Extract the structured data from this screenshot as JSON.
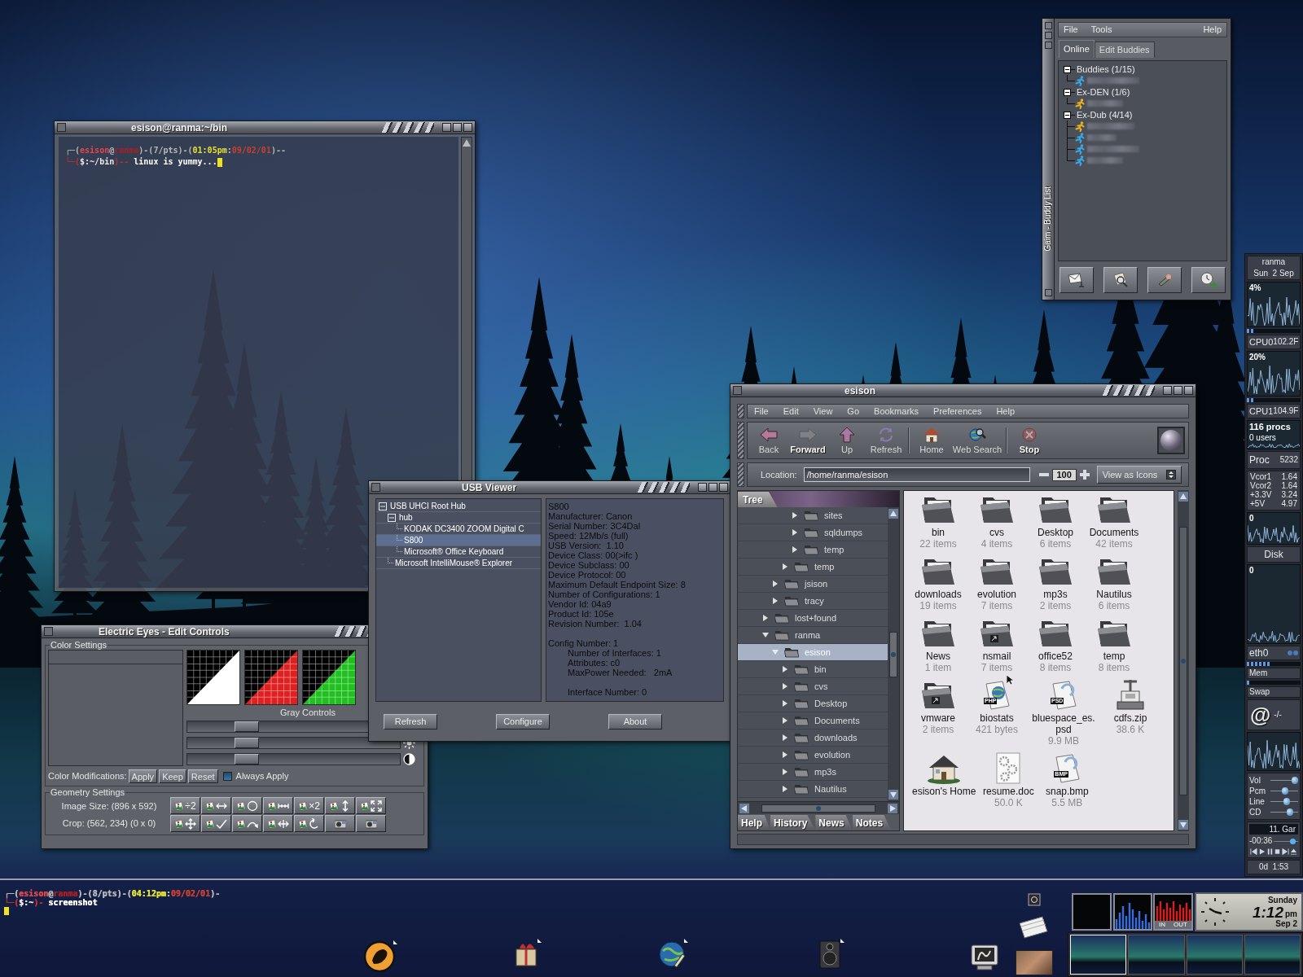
{
  "terminal": {
    "title": "esison@ranma:~/bin",
    "lines": [
      {
        "segments": [
          {
            "text": "┌─(",
            "color": "#b8b8b8"
          },
          {
            "text": "esison",
            "color": "#e04848"
          },
          {
            "text": "@",
            "color": "#b8b8b8"
          },
          {
            "text": "ranma",
            "color": "#a82020"
          },
          {
            "text": ")-(",
            "color": "#b8b8b8"
          },
          {
            "text": "7/pts",
            "color": "#b8b8b8"
          },
          {
            "text": ")-(",
            "color": "#b8b8b8"
          },
          {
            "text": "01:05pm",
            "color": "#e8e030"
          },
          {
            "text": ":",
            "color": "#b8b8b8"
          },
          {
            "text": "09/02/01",
            "color": "#c84030"
          },
          {
            "text": ")--",
            "color": "#b8b8b8"
          }
        ]
      },
      {
        "segments": [
          {
            "text": "└─(",
            "color": "#c03030"
          },
          {
            "text": "$:~/bin",
            "color": "#e8e8e8"
          },
          {
            "text": ")--",
            "color": "#c03030"
          },
          {
            "text": " linux is yummy...",
            "color": "#ffffff"
          }
        ],
        "cursor": true
      }
    ]
  },
  "buddy_list": {
    "title": "Gaim - Buddy List",
    "menu": [
      "File",
      "Tools",
      "Help"
    ],
    "tabs": [
      {
        "label": "Online",
        "selected": true
      },
      {
        "label": "Edit Buddies",
        "selected": false
      }
    ],
    "groups": [
      {
        "label": "Buddies (1/15)",
        "expanded": true,
        "children": [
          {
            "away": false
          }
        ]
      },
      {
        "label": "Ex-DEN (1/6)",
        "expanded": true,
        "children": [
          {
            "away": true
          }
        ]
      },
      {
        "label": "Ex-Dub (4/14)",
        "expanded": true,
        "children": [
          {
            "away": true
          },
          {
            "away": false
          },
          {
            "away": false
          },
          {
            "away": false
          }
        ]
      }
    ]
  },
  "electric_eyes": {
    "title": "Electric Eyes - Edit Controls",
    "color_settings": {
      "label": "Color Settings",
      "swatches": [
        {
          "color": "#ffffff"
        },
        {
          "color": "#e02020"
        },
        {
          "color": "#20c020"
        }
      ],
      "controls_label": "Gray Controls",
      "sliders": [
        {
          "kind": "plain",
          "level": 0.25
        },
        {
          "kind": "brightness",
          "level": 0.25
        },
        {
          "kind": "contrast",
          "level": 0.25
        }
      ],
      "modifications_label": "Color Modifications:",
      "buttons": [
        "Apply",
        "Keep",
        "Reset"
      ],
      "always_apply": {
        "label": "Always Apply",
        "checked": false
      }
    },
    "geometry": {
      "label": "Geometry Settings",
      "image_size": "Image Size: (896 x 592)",
      "crop": "Crop: (562, 234) (0 x 0)",
      "buttons": [
        {
          "kind": "scale",
          "glyph": "÷2"
        },
        {
          "kind": "shrink"
        },
        {
          "kind": "circle"
        },
        {
          "kind": "grow"
        },
        {
          "kind": "scale",
          "glyph": "×2"
        },
        {
          "kind": "flip-vertical"
        },
        {
          "kind": "fit"
        },
        {
          "kind": "move"
        },
        {
          "kind": "check"
        },
        {
          "kind": "rotate-arc"
        },
        {
          "kind": "flip-horizontal"
        },
        {
          "kind": "rotate"
        },
        {
          "kind": "camera"
        },
        {
          "kind": "camera"
        }
      ]
    }
  },
  "usb_viewer": {
    "title": "USB Viewer",
    "tree": [
      {
        "label": "USB UHCI Root Hub",
        "expanded": true,
        "selected": false,
        "children": [
          {
            "label": "hub",
            "expanded": true,
            "selected": false,
            "children": [
              {
                "label": "KODAK DC3400 ZOOM Digital C",
                "selected": false
              },
              {
                "label": "S800",
                "selected": true
              },
              {
                "label": "Microsoft® Office Keyboard",
                "selected": false
              }
            ]
          },
          {
            "label": "Microsoft IntelliMouse® Explorer",
            "selected": false
          }
        ]
      }
    ],
    "details": [
      "S800",
      "Manufacturer: Canon",
      "Serial Number: 3C4Dal",
      "Speed: 12Mb/s (full)",
      "USB Version:  1.10",
      "Device Class: 00(>ifc )",
      "Device Subclass: 00",
      "Device Protocol: 00",
      "Maximum Default Endpoint Size: 8",
      "Number of Configurations: 1",
      "Vendor Id: 04a9",
      "Product Id: 105e",
      "Revision Number:  1.04"
    ],
    "config": {
      "heading": "Config Number: 1",
      "lines": [
        "Number of Interfaces: 1",
        "Attributes: c0",
        "MaxPower Needed:   2mA"
      ],
      "interface": "Interface Number: 0"
    },
    "buttons": [
      "Refresh",
      "Configure",
      "About"
    ]
  },
  "file_manager": {
    "title": "esison",
    "menu": [
      "File",
      "Edit",
      "View",
      "Go",
      "Bookmarks",
      "Preferences",
      "Help"
    ],
    "toolbar": [
      {
        "kind": "back",
        "label": "Back",
        "disabled": false
      },
      {
        "kind": "forward",
        "label": "Forward",
        "disabled": true
      },
      {
        "kind": "up",
        "label": "Up",
        "disabled": false
      },
      {
        "kind": "refresh",
        "label": "Refresh",
        "disabled": false,
        "separator_after": true
      },
      {
        "kind": "home",
        "label": "Home",
        "disabled": false
      },
      {
        "kind": "search",
        "label": "Web Search",
        "disabled": false,
        "separator_after": true
      },
      {
        "kind": "stop",
        "label": "Stop",
        "disabled": true
      }
    ],
    "location": {
      "label": "Location:",
      "value": "/home/ranma/esison"
    },
    "zoom": "100",
    "view_as": "View as Icons",
    "sidebar": {
      "open_panel": "Tree",
      "tree": [
        {
          "children": [
            {
              "children": [
                {
                  "children": [
                    {
                      "label": "sites",
                      "expanded": false,
                      "selected": false
                    },
                    {
                      "label": "sqldumps",
                      "expanded": false,
                      "selected": false
                    },
                    {
                      "label": "temp",
                      "expanded": false,
                      "selected": false
                    }
                  ]
                },
                {
                  "label": "temp",
                  "expanded": false,
                  "selected": false
                }
              ]
            },
            {
              "label": "jsison",
              "expanded": false,
              "selected": false
            },
            {
              "label": "tracy",
              "expanded": false,
              "selected": false
            }
          ]
        },
        {
          "label": "lost+found",
          "expanded": false,
          "selected": false
        },
        {
          "label": "ranma",
          "expanded": true,
          "selected": false,
          "children": [
            {
              "label": "esison",
              "expanded": true,
              "selected": true,
              "children": [
                {
                  "label": "bin",
                  "expanded": false,
                  "selected": false
                },
                {
                  "label": "cvs",
                  "expanded": false,
                  "selected": false
                },
                {
                  "label": "Desktop",
                  "expanded": false,
                  "selected": false
                },
                {
                  "label": "Documents",
                  "expanded": false,
                  "selected": false
                },
                {
                  "label": "downloads",
                  "expanded": false,
                  "selected": false
                },
                {
                  "label": "evolution",
                  "expanded": false,
                  "selected": false
                },
                {
                  "label": "mp3s",
                  "expanded": false,
                  "selected": false
                },
                {
                  "label": "Nautilus",
                  "expanded": false,
                  "selected": false
                }
              ]
            }
          ]
        }
      ],
      "tabs": [
        {
          "label": "Help",
          "selected": false
        },
        {
          "label": "History",
          "selected": false
        },
        {
          "label": "News",
          "selected": false
        },
        {
          "label": "Notes",
          "selected": false
        }
      ]
    },
    "icons": [
      {
        "name": "bin",
        "info": "22 items",
        "kind": "folder"
      },
      {
        "name": "cvs",
        "info": "4 items",
        "kind": "folder"
      },
      {
        "name": "Desktop",
        "info": "6 items",
        "kind": "folder"
      },
      {
        "name": "Documents",
        "info": "42 items",
        "kind": "folder"
      },
      {
        "name": "downloads",
        "info": "19 items",
        "kind": "folder"
      },
      {
        "name": "evolution",
        "info": "7 items",
        "kind": "folder"
      },
      {
        "name": "mp3s",
        "info": "2 items",
        "kind": "folder"
      },
      {
        "name": "Nautilus",
        "info": "6 items",
        "kind": "folder"
      },
      {
        "name": "News",
        "info": "1 item",
        "kind": "folder"
      },
      {
        "name": "nsmail",
        "info": "7 items",
        "kind": "folder-link"
      },
      {
        "name": "office52",
        "info": "8 items",
        "kind": "folder"
      },
      {
        "name": "temp",
        "info": "8 items",
        "kind": "folder"
      },
      {
        "name": "vmware",
        "info": "2 items",
        "kind": "folder-link"
      },
      {
        "name": "biostats",
        "info": "421 bytes",
        "kind": "web-file",
        "badge": "PHP"
      },
      {
        "name": "bluespace_es.psd",
        "info": "9.9 MB",
        "kind": "image-file",
        "badge": "PSD"
      },
      {
        "name": "cdfs.zip",
        "info": "38.6 K",
        "kind": "archive"
      },
      {
        "name": "esison's Home",
        "kind": "home"
      },
      {
        "name": "resume.doc",
        "info": "50.0 K",
        "kind": "document"
      },
      {
        "name": "snap.bmp",
        "info": "5.5 MB",
        "kind": "image-file",
        "badge": "BMP"
      }
    ]
  },
  "gkrellm": {
    "host": "ranma",
    "date": "Sun  2 Sep",
    "cpus": [
      {
        "chart_label": "4%",
        "name": "CPU0",
        "temp": "102.2F",
        "level": 0.15
      },
      {
        "chart_label": "20%",
        "name": "CPU1",
        "temp": "104.9F",
        "level": 0.15
      }
    ],
    "procs": {
      "procs": "116 procs",
      "users": "0 users"
    },
    "proc": {
      "label": "Proc",
      "value": "5232"
    },
    "sensors": [
      {
        "name": "Vcor1",
        "value": "1.64"
      },
      {
        "name": "Vcor2",
        "value": "1.64"
      },
      {
        "name": "+3.3V",
        "value": "3.24"
      },
      {
        "name": "+5V",
        "value": "4.97"
      }
    ],
    "sensor_chart_label": "0",
    "disk": {
      "label": "Disk",
      "chart_label": "0"
    },
    "net": {
      "label": "eth0"
    },
    "mem": {
      "label": "Mem",
      "level": 0.45
    },
    "swap": {
      "label": "Swap",
      "level": 0.05
    },
    "mail": {
      "icon": "@",
      "count": "-/-"
    },
    "mixer": [
      {
        "label": "Vol",
        "level": 1
      },
      {
        "label": "Pcm",
        "level": 0.55
      },
      {
        "label": "Line",
        "level": 0.6
      },
      {
        "label": "CD",
        "level": 0.75
      }
    ],
    "player": {
      "title": "11. Gar",
      "time": "-00:36",
      "level": 0.85
    },
    "uptime": "0d  1:53"
  },
  "bottom_terminal": {
    "lines": [
      {
        "segments": [
          {
            "text": "┌─(",
            "color": "#b8b8b8"
          },
          {
            "text": "esison",
            "color": "#e04848"
          },
          {
            "text": "@",
            "color": "#b8b8b8"
          },
          {
            "text": "ranma",
            "color": "#a82020"
          },
          {
            "text": ")-(",
            "color": "#b8b8b8"
          },
          {
            "text": "8/pts",
            "color": "#b8b8b8"
          },
          {
            "text": ")-(",
            "color": "#b8b8b8"
          },
          {
            "text": "04:12pm",
            "color": "#e8e030"
          },
          {
            "text": ":",
            "color": "#b8b8b8"
          },
          {
            "text": "09/02/01",
            "color": "#c84030"
          },
          {
            "text": ")-",
            "color": "#b8b8b8"
          }
        ]
      },
      {
        "segments": [
          {
            "text": "└─(",
            "color": "#c03030"
          },
          {
            "text": "$:~",
            "color": "#e8e8e8"
          },
          {
            "text": ")-",
            "color": "#c03030"
          },
          {
            "text": " screenshot",
            "color": "#ffffff"
          }
        ]
      },
      {
        "cursor": true
      }
    ]
  },
  "dock": {
    "meter_labels": [
      "IN",
      "OUT"
    ],
    "clock": {
      "day": "Sunday",
      "time": "1:12",
      "period": "pm",
      "date": "Sep 2"
    }
  }
}
